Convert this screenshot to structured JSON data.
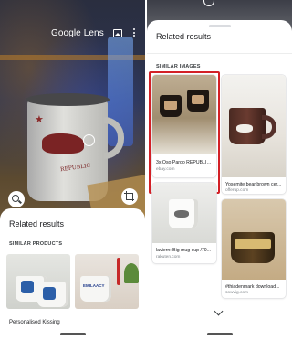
{
  "left_screen": {
    "header": {
      "title": "Google Lens",
      "gallery_icon": "gallery-icon",
      "more_icon": "more-vert-icon"
    },
    "camera": {
      "mug_text": "REPUBLIC"
    },
    "controls": {
      "search_icon": "search-icon",
      "crop_icon": "crop-icon"
    },
    "sheet": {
      "title": "Related results",
      "section": "SIMILAR PRODUCTS",
      "products": [
        {
          "title": "Personalised Kissing"
        },
        {
          "title": "",
          "badge": "EMILAACY"
        }
      ]
    }
  },
  "right_screen": {
    "sheet": {
      "title": "Related results",
      "section": "SIMILAR IMAGES",
      "results": [
        {
          "title": "3x Oso Pardo REPUBLIC...",
          "site": "ebay.com",
          "highlighted": true
        },
        {
          "title": "Yosemite bear brown cer...",
          "site": "offerup.com",
          "highlighted": false
        },
        {
          "title": "laviern: Big mug cup /70...",
          "site": "rakuten.com",
          "highlighted": false
        },
        {
          "title": "#thiadenmark download...",
          "site": "sowvig.com",
          "highlighted": false
        }
      ],
      "expand_icon": "chevron-down-icon"
    }
  },
  "colors": {
    "highlight": "#d32026",
    "text_primary": "#202124",
    "text_secondary": "#80868b"
  }
}
